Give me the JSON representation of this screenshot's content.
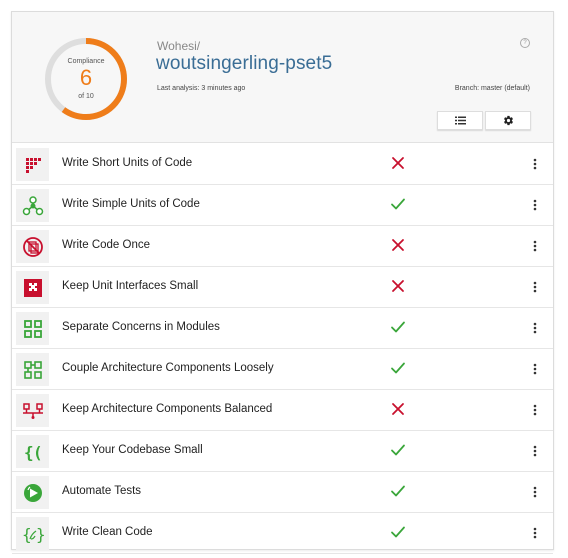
{
  "header": {
    "gauge": {
      "title": "Compliance",
      "value": "6",
      "total": "of 10",
      "fraction": 0.6,
      "color": "#ef7d1a"
    },
    "org": "Wohesi/",
    "repo": "woutsingerling-pset5",
    "help_icon": "help-icon",
    "last_analysis": "Last analysis: 3 minutes ago",
    "branch": "Branch: master (default)",
    "buttons": [
      {
        "icon": "list-icon"
      },
      {
        "icon": "gear-icon"
      }
    ]
  },
  "colors": {
    "fail": "#c8102e",
    "pass": "#3aa63a",
    "gauge_track": "#dedede"
  },
  "guidelines": [
    {
      "label": "Write Short Units of Code",
      "passed": false,
      "icon": "short-units-icon"
    },
    {
      "label": "Write Simple Units of Code",
      "passed": true,
      "icon": "simple-units-icon"
    },
    {
      "label": "Write Code Once",
      "passed": false,
      "icon": "code-once-icon"
    },
    {
      "label": "Keep Unit Interfaces Small",
      "passed": false,
      "icon": "unit-interfaces-icon"
    },
    {
      "label": "Separate Concerns in Modules",
      "passed": true,
      "icon": "separate-concerns-icon"
    },
    {
      "label": "Couple Architecture Components Loosely",
      "passed": true,
      "icon": "couple-components-icon"
    },
    {
      "label": "Keep Architecture Components Balanced",
      "passed": false,
      "icon": "balanced-components-icon"
    },
    {
      "label": "Keep Your Codebase Small",
      "passed": true,
      "icon": "small-codebase-icon"
    },
    {
      "label": "Automate Tests",
      "passed": true,
      "icon": "automate-tests-icon"
    },
    {
      "label": "Write Clean Code",
      "passed": true,
      "icon": "clean-code-icon"
    }
  ]
}
